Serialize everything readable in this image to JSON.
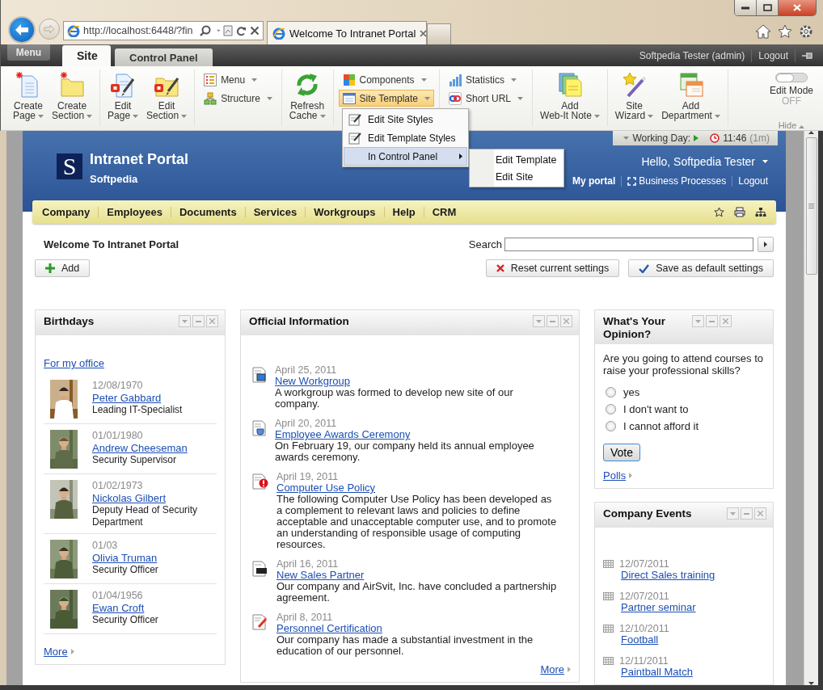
{
  "browser": {
    "address": "http://localhost:6448/?fin",
    "tabs": [
      {
        "title": "Welcome To Intranet Portal",
        "selected": true
      }
    ]
  },
  "admin_bar": {
    "menu_button": "Menu",
    "tabs": [
      {
        "label": "Site",
        "selected": true
      },
      {
        "label": "Control Panel",
        "selected": false
      }
    ],
    "user": "Softpedia Tester (admin)",
    "logout": "Logout"
  },
  "toolbar": {
    "groups": [
      {
        "items": [
          {
            "kind": "large",
            "label": "Create Page",
            "dropdown": true,
            "selected": false
          },
          {
            "kind": "large",
            "label": "Create Section",
            "dropdown": true,
            "selected": false
          }
        ]
      },
      {
        "items": [
          {
            "kind": "large",
            "label": "Edit Page",
            "dropdown": true,
            "selected": false
          },
          {
            "kind": "large",
            "label": "Edit Section",
            "dropdown": true,
            "selected": false
          }
        ]
      },
      {
        "items": [
          {
            "kind": "small",
            "label": "Menu",
            "dropdown": true,
            "selected": false
          },
          {
            "kind": "small",
            "label": "Structure",
            "dropdown": true,
            "selected": false
          }
        ]
      },
      {
        "items": [
          {
            "kind": "large",
            "label": "Refresh Cache",
            "dropdown": true,
            "selected": false
          }
        ]
      },
      {
        "items": [
          {
            "kind": "small",
            "label": "Components",
            "dropdown": true,
            "selected": false
          },
          {
            "kind": "small",
            "label": "Site Template",
            "dropdown": true,
            "selected": true
          }
        ]
      },
      {
        "items": [
          {
            "kind": "small",
            "label": "Statistics",
            "dropdown": true,
            "selected": false
          },
          {
            "kind": "small",
            "label": "Short URL",
            "dropdown": true,
            "selected": false
          }
        ]
      },
      {
        "items": [
          {
            "kind": "large",
            "label": "Add Web-It Note",
            "dropdown": true,
            "selected": false
          }
        ]
      },
      {
        "items": [
          {
            "kind": "large",
            "label": "Site Wizard",
            "dropdown": true,
            "selected": false
          },
          {
            "kind": "large",
            "label": "Add Department",
            "dropdown": true,
            "selected": false
          }
        ]
      }
    ],
    "edit_mode": {
      "label": "Edit Mode",
      "state": "OFF",
      "on": false
    },
    "hide": "Hide"
  },
  "site_template_menu": {
    "items": [
      {
        "label": "Edit Site Styles",
        "selected": false,
        "submenu": false
      },
      {
        "label": "Edit Template Styles",
        "selected": false,
        "submenu": false
      },
      {
        "label": "In Control Panel",
        "selected": true,
        "submenu": true
      }
    ],
    "submenu_items": [
      {
        "label": "Edit Template"
      },
      {
        "label": "Edit Site"
      }
    ]
  },
  "header": {
    "working_day": {
      "label": "Working Day:",
      "time": "11:46",
      "duration": "(1m)"
    },
    "logo": "S",
    "title": "Intranet Portal",
    "subtitle": "Softpedia",
    "greeting": "Hello, Softpedia Tester",
    "links": [
      "My portal",
      "Business Processes",
      "Logout"
    ]
  },
  "nav": {
    "items": [
      "Company",
      "Employees",
      "Documents",
      "Services",
      "Workgroups",
      "Help",
      "CRM"
    ]
  },
  "welcome": {
    "title": "Welcome To Intranet Portal",
    "search_label": "Search",
    "add_button": "Add",
    "reset_button": "Reset current settings",
    "save_button": "Save as default settings"
  },
  "birthdays": {
    "title": "Birthdays",
    "filter": "For my office",
    "people": [
      {
        "date": "12/08/1970",
        "name": "Peter Gabbard",
        "position": "Leading IT-Specialist"
      },
      {
        "date": "01/01/1980",
        "name": "Andrew Cheeseman",
        "position": "Security Supervisor"
      },
      {
        "date": "01/02/1973",
        "name": "Nickolas Gilbert",
        "position": "Deputy Head of Security Department"
      },
      {
        "date": "01/03",
        "name": "Olivia Truman",
        "position": "Security Officer"
      },
      {
        "date": "01/04/1956",
        "name": "Ewan Croft",
        "position": "Security Officer"
      }
    ],
    "more": "More"
  },
  "official_information": {
    "title": "Official Information",
    "items": [
      {
        "date": "April 25, 2011",
        "title": "New Workgroup",
        "text": "A workgroup was formed to develop new site of our company."
      },
      {
        "date": "April 20, 2011",
        "title": "Employee Awards Ceremony",
        "text": "On February 19, our company held its annual employee awards ceremony."
      },
      {
        "date": "April 19, 2011",
        "title": "Computer Use Policy",
        "text": "The following Computer Use Policy has been developed as a complement to relevant laws and policies to define acceptable and unacceptable computer use, and to promote an understanding of responsible usage of computing resources."
      },
      {
        "date": "April 16, 2011",
        "title": "New Sales Partner",
        "text": "Our company and AirSvit, Inc. have concluded a partnership agreement."
      },
      {
        "date": "April 8, 2011",
        "title": "Personnel Certification",
        "text": "Our company has made a substantial investment in the education of our personnel."
      }
    ],
    "more": "More"
  },
  "poll": {
    "title": "What's Your Opinion?",
    "question": "Are you going to attend courses to raise your professional skills?",
    "options": [
      {
        "label": "yes",
        "selected": false
      },
      {
        "label": "I don't want to",
        "selected": false
      },
      {
        "label": "I cannot afford it",
        "selected": false
      }
    ],
    "vote_button": "Vote",
    "polls_link": "Polls"
  },
  "company_events": {
    "title": "Company Events",
    "items": [
      {
        "date": "12/07/2011",
        "title": "Direct Sales training"
      },
      {
        "date": "12/07/2011",
        "title": "Partner seminar"
      },
      {
        "date": "12/10/2011",
        "title": "Football"
      },
      {
        "date": "12/11/2011",
        "title": "Paintball Match"
      }
    ]
  }
}
